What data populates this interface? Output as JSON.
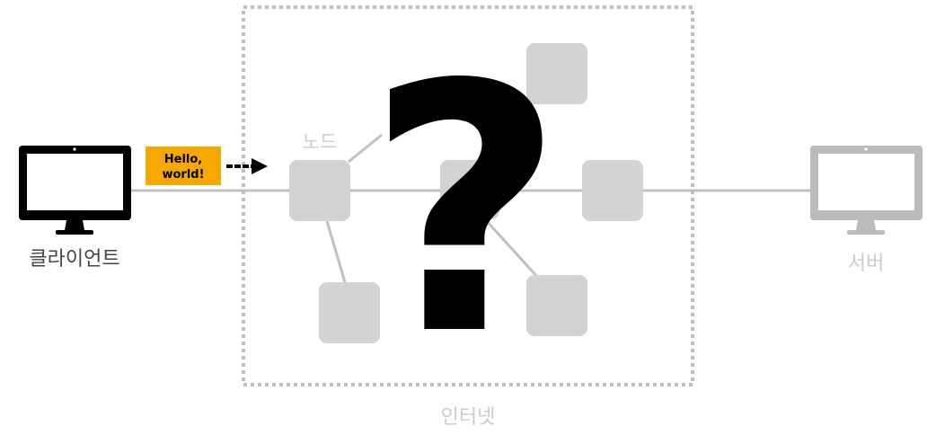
{
  "client": {
    "label": "클라이언트"
  },
  "server": {
    "label": "서버"
  },
  "internet": {
    "label": "인터넷"
  },
  "node": {
    "label": "노드"
  },
  "message": {
    "line1": "Hello,",
    "line2": "world!"
  },
  "mystery": {
    "symbol": "?"
  },
  "colors": {
    "client": "#000000",
    "server": "#bbbbbb",
    "node": "#d3d3d3",
    "link": "#c0c0c0",
    "message_bg": "#f5a800",
    "boundary": "#bfbfbf",
    "faded_label": "#cccccc",
    "client_label": "#444444"
  }
}
